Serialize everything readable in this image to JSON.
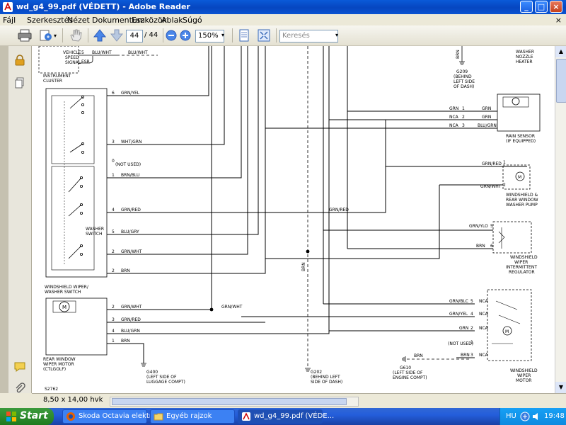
{
  "window": {
    "title": "wd_g4_99.pdf (VÉDETT) - Adobe Reader",
    "controls": {
      "minimize": "_",
      "maximize": "□",
      "close": "×"
    }
  },
  "menu": {
    "items": [
      "Fájl",
      "Szerkesztés",
      "Nézet",
      "Dokumentum",
      "Eszközök",
      "Ablak",
      "Súgó"
    ],
    "close_doc": "×"
  },
  "toolbar": {
    "page_current": "44",
    "page_total": "/ 44",
    "zoom": "150%",
    "search_placeholder": "Keresés",
    "icons": [
      "printer-icon",
      "share-icon",
      "hand-tool-icon",
      "prev-page-icon",
      "next-page-icon",
      "zoom-out-icon",
      "zoom-in-icon",
      "fit-page-icon",
      "fullscreen-icon"
    ]
  },
  "leftpanel": {
    "icons": [
      "padlock-icon",
      "pages-icon",
      "comments-icon",
      "attachments-icon"
    ]
  },
  "diagram": {
    "labels": {
      "vehicle_speed_signal": [
        "VEHICLE",
        "SPEED",
        "SIGNAL"
      ],
      "instrument_cluster": [
        "INSTRUMENT",
        "CLUSTER"
      ],
      "esr": "ESR",
      "windshield_washer_switch": [
        "WINDSHIELD WIPER/",
        "WASHER SWITCH"
      ],
      "washer_switch": [
        "WASHER",
        "SWITCH"
      ],
      "not_used": "(NOT USED)",
      "rear_window_wiper_motor": [
        "REAR WINDOW",
        "WIPER MOTOR",
        "(CTLGOLF)"
      ],
      "g400": [
        "G400",
        "(LEFT SIDE OF",
        "LUGGAGE COMPT)"
      ],
      "g202": [
        "G202",
        "(BEHIND LEFT",
        "SIDE OF DASH)"
      ],
      "g610": [
        "G610",
        "(LEFT SIDE OF",
        "ENGINE COMPT)"
      ],
      "g209": [
        "G209",
        "(BEHIND",
        "LEFT SIDE",
        "OF DASH)"
      ],
      "nozzle_heater": [
        "WASHER",
        "NOZZLE",
        "HEATER"
      ],
      "rain_sensor": [
        "RAIN SENSOR",
        "(IF EQUIPPED)"
      ],
      "washer_pump": [
        "WINDSHIELD &",
        "REAR WINDOW",
        "WASHER PUMP"
      ],
      "intermittent_regulator": [
        "WINDSHIELD",
        "WIPER",
        "INTERMITTENT",
        "REGULATOR"
      ],
      "wiper_motor": [
        "WINDSHIELD",
        "WIPER",
        "MOTOR"
      ],
      "page_code": "S2762",
      "switch_not_used": "(NOT USED)"
    },
    "left_wires": [
      {
        "pin": "5",
        "color": "BLU/WHT",
        "extra": "BLU/WHT"
      },
      {
        "pin": "6",
        "color": "GRN/YEL"
      },
      {
        "pin": "3",
        "color": "WHT/GRN"
      },
      {
        "pin": "0",
        "color": ""
      },
      {
        "pin": "1",
        "color": "BRN/BLU"
      },
      {
        "pin": "4",
        "color": "GRN/RED",
        "extra": "GRN/RED"
      },
      {
        "pin": "5",
        "color": "BLU/GRY"
      },
      {
        "pin": "2",
        "color": "GRN/WHT"
      },
      {
        "pin": "2",
        "color": "BRN"
      },
      {
        "pin": "2",
        "color": "GRN/WHT",
        "extra": "GRN/WHT"
      },
      {
        "pin": "3",
        "color": "GRN/RED"
      },
      {
        "pin": "4",
        "color": "BLU/GRN"
      },
      {
        "pin": "1",
        "color": "BRN"
      }
    ],
    "rain_sensor_wires": [
      {
        "left": "GRN",
        "pin": "1",
        "right": "GRN"
      },
      {
        "left": "NCA",
        "pin": "2",
        "right": "GRN"
      },
      {
        "left": "NCA",
        "pin": "3",
        "right": "BLU/GRN"
      }
    ],
    "pump_wires": [
      {
        "color": "GRN/RED",
        "pin": "1"
      },
      {
        "color": "GRN/WHT",
        "pin": "2"
      }
    ],
    "regulator_wires": [
      {
        "color": "GRN/YLO",
        "pin": "5"
      },
      {
        "color": "BRN",
        "pin": "6"
      }
    ],
    "motor_wires": [
      {
        "color": "GRN/BLC",
        "pin": "5",
        "nca": "NCA"
      },
      {
        "color": "GRN/YEL",
        "pin": "4",
        "nca": "NCA"
      },
      {
        "color": "GRN",
        "pin": "2",
        "nca": "NCA"
      },
      {
        "color": "(NOT USED)",
        "pin": "1",
        "nca": ""
      },
      {
        "color": "BRN",
        "pin": "3",
        "nca": "NCA"
      }
    ],
    "g209_wire": "BRN",
    "g202_wire": "BRN",
    "g610_wire": "BRN"
  },
  "status": {
    "page_size": "8,50 x 14,00 hvk"
  },
  "taskbar": {
    "start": "Start",
    "tasks": [
      {
        "label": "Skoda Octavia elektr...",
        "icon": "firefox-icon",
        "active": false
      },
      {
        "label": "Egyéb rajzok",
        "icon": "folder-icon",
        "active": false
      },
      {
        "label": "wd_g4_99.pdf (VÉDE...",
        "icon": "pdf-icon",
        "active": true
      }
    ],
    "lang": "HU",
    "clock": "19:48"
  }
}
